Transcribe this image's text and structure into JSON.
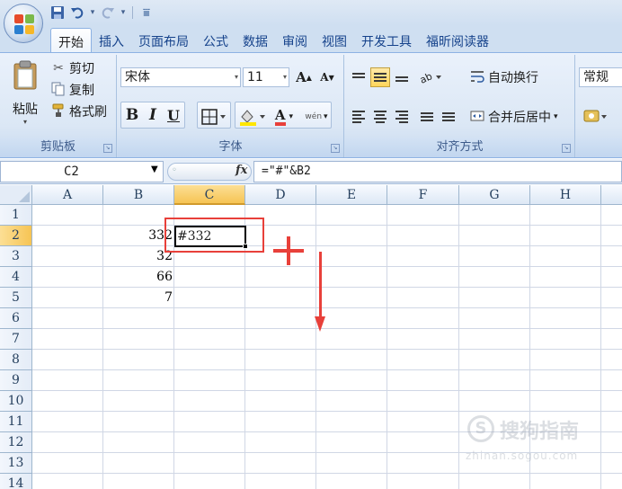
{
  "quick_access": {
    "save_icon": "save-icon",
    "undo_icon": "undo-icon",
    "redo_icon": "redo-icon",
    "customize_glyph": "⩸"
  },
  "tabs": [
    {
      "label": "开始",
      "active": true
    },
    {
      "label": "插入"
    },
    {
      "label": "页面布局"
    },
    {
      "label": "公式"
    },
    {
      "label": "数据"
    },
    {
      "label": "审阅"
    },
    {
      "label": "视图"
    },
    {
      "label": "开发工具"
    },
    {
      "label": "福昕阅读器"
    }
  ],
  "ribbon": {
    "clipboard": {
      "paste": "粘贴",
      "cut": "剪切",
      "copy": "复制",
      "format_painter": "格式刷",
      "group_label": "剪贴板"
    },
    "font": {
      "font_name": "宋体",
      "font_size": "11",
      "grow_font": "A",
      "shrink_font": "A",
      "bold": "B",
      "italic": "I",
      "underline": "U",
      "font_color_glyph": "A",
      "phonetic_glyph": "wén",
      "group_label": "字体"
    },
    "alignment": {
      "wrap_text": "自动换行",
      "merge_center": "合并后居中",
      "group_label": "对齐方式"
    },
    "number": {
      "format": "常规"
    }
  },
  "formula_bar": {
    "name_box": "C2",
    "fx": "fx",
    "formula": "=\"#\"&B2"
  },
  "sheet": {
    "columns": [
      "A",
      "B",
      "C",
      "D",
      "E",
      "F",
      "G",
      "H"
    ],
    "rows": [
      "1",
      "2",
      "3",
      "4",
      "5",
      "6",
      "7",
      "8",
      "9",
      "10",
      "11",
      "12",
      "13",
      "14"
    ],
    "selected_column": "C",
    "selected_row": "2",
    "cells": {
      "B2": "332",
      "B3": "32",
      "B4": "66",
      "B5": "7",
      "C2": "#332"
    }
  },
  "colors": {
    "annotation_red": "#e8403a",
    "selection_header": "#f6c454",
    "ribbon_blue": "#dbe7f5"
  },
  "watermark": {
    "text": "搜狗指南",
    "url": "zhinan.sogou.com"
  }
}
